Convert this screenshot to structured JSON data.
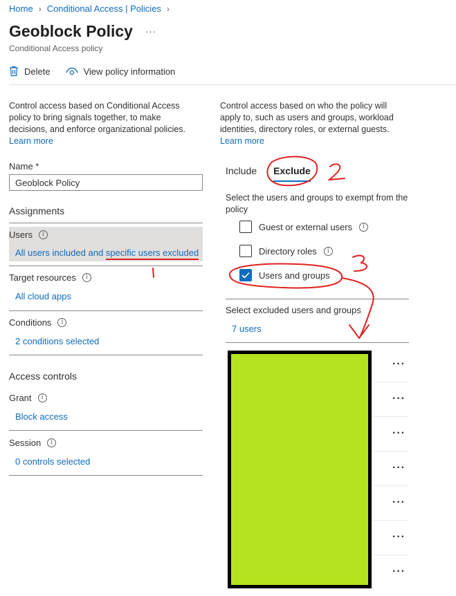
{
  "breadcrumb": [
    "Home",
    "Conditional Access | Policies"
  ],
  "title": "Geoblock Policy",
  "title_more": "···",
  "subtitle": "Conditional Access policy",
  "toolbar": {
    "delete_label": "Delete",
    "view_info_label": "View policy information"
  },
  "left": {
    "description": "Control access based on Conditional Access policy to bring signals together, to make decisions, and enforce organizational policies.",
    "learn_more": "Learn more",
    "name_label": "Name *",
    "name_value": "Geoblock Policy",
    "assignments_heading": "Assignments",
    "users_title": "Users",
    "users_value_prefix": "All users included and ",
    "users_value_link": "specific users excluded",
    "target_title": "Target resources",
    "target_value": "All cloud apps",
    "conditions_title": "Conditions",
    "conditions_value": "2 conditions selected",
    "access_heading": "Access controls",
    "grant_title": "Grant",
    "grant_value": "Block access",
    "session_title": "Session",
    "session_value": "0 controls selected"
  },
  "right": {
    "description": "Control access based on who the policy will apply to, such as users and groups, workload identities, directory roles, or external guests.",
    "learn_more": "Learn more",
    "tab_include": "Include",
    "tab_exclude": "Exclude",
    "exempt_text": "Select the users and groups to exempt from the policy",
    "options": [
      {
        "label": "Guest or external users",
        "checked": false
      },
      {
        "label": "Directory roles",
        "checked": false
      },
      {
        "label": "Users and groups",
        "checked": true
      }
    ],
    "excluded_label": "Select excluded users and groups",
    "users_count": "7 users",
    "row_more": "···"
  },
  "annotations": {
    "marks": [
      "1",
      "2",
      "3"
    ],
    "color": "#e02020"
  },
  "colors": {
    "accent": "#0f6cbd",
    "redaction": "#b5e31f",
    "selected_bg": "#e1dfdd"
  }
}
